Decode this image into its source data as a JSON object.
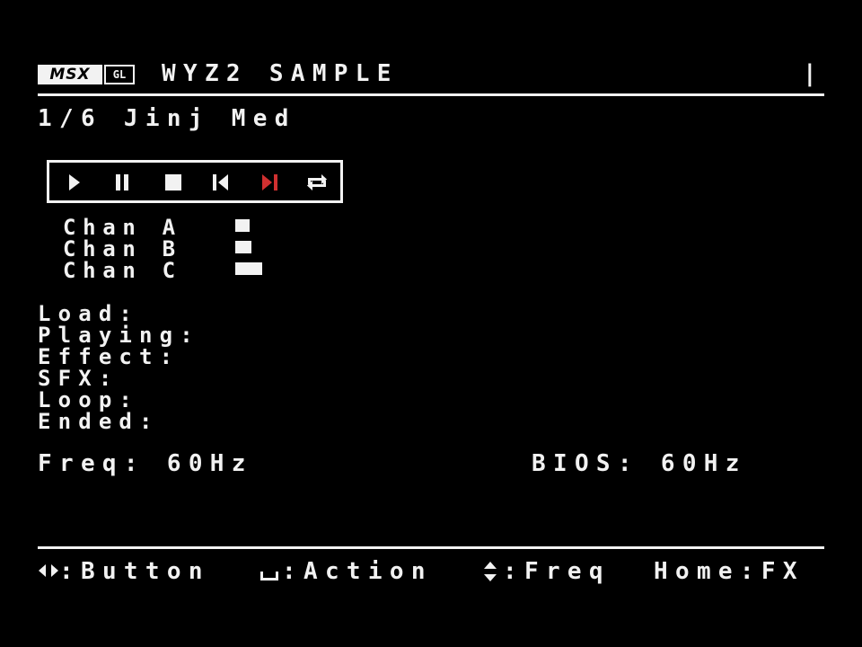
{
  "header": {
    "logo_main": "MSX",
    "logo_sub": "GL",
    "title": "WYZ2 SAMPLE",
    "indicator": "|"
  },
  "song": {
    "label": "1/6 Jinj Med"
  },
  "controls": [
    {
      "name": "play",
      "icon": "play-icon",
      "active": false
    },
    {
      "name": "pause",
      "icon": "pause-icon",
      "active": false
    },
    {
      "name": "stop",
      "icon": "stop-icon",
      "active": false
    },
    {
      "name": "previous",
      "icon": "skip-previous-icon",
      "active": false
    },
    {
      "name": "next",
      "icon": "skip-next-icon",
      "active": true
    },
    {
      "name": "loop",
      "icon": "repeat-icon",
      "active": false
    }
  ],
  "colors": {
    "background": "#000000",
    "foreground": "#f2f2f2",
    "active": "#d03030"
  },
  "channels": [
    {
      "label": "Chan A",
      "level": 1
    },
    {
      "label": "Chan B",
      "level": 1
    },
    {
      "label": "Chan C",
      "level": 2
    }
  ],
  "status": {
    "load": "Load:",
    "playing": "Playing:",
    "effect": "Effect:",
    "sfx": "SFX:",
    "loop": "Loop:",
    "ended": "Ended:"
  },
  "freq": {
    "label": "Freq: 60Hz",
    "bios": "BIOS: 60Hz"
  },
  "footer": {
    "button_hint": ":Button",
    "action_hint": ":Action",
    "freq_hint": ":Freq",
    "home_hint": "Home:FX"
  }
}
